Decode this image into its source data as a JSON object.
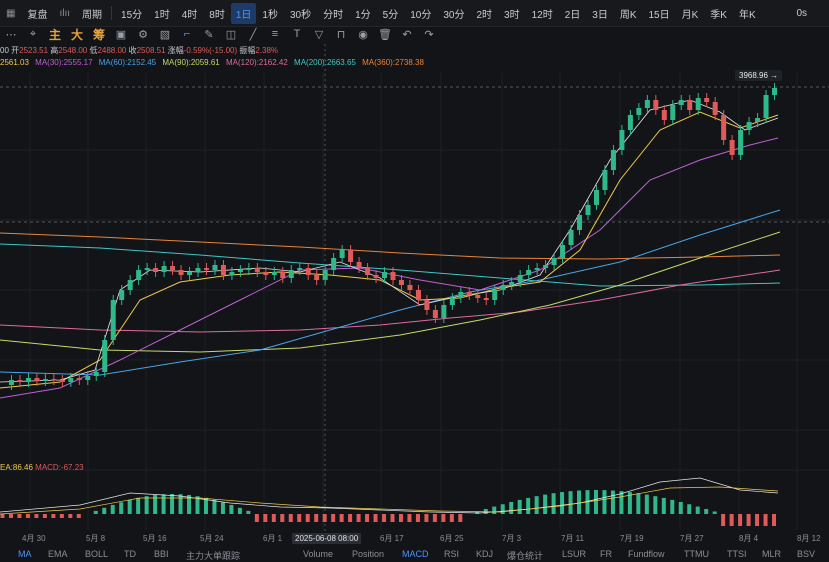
{
  "topbar": {
    "items": [
      "复盘",
      "周期",
      "15分",
      "1时",
      "4时",
      "8时",
      "1日",
      "1秒",
      "30秒",
      "分时",
      "1分",
      "5分",
      "10分",
      "30分",
      "2时",
      "3时",
      "12时",
      "2日",
      "3日",
      "周K",
      "15日",
      "月K",
      "季K",
      "年K"
    ],
    "active": "1日",
    "right": "0s"
  },
  "toolbar": {
    "main": "主",
    "big": "大",
    "chip": "筹"
  },
  "ohlc": {
    "prev_fragment": "00",
    "open_label": "开",
    "open": "2523.51",
    "high_label": "高",
    "high": "2548.00",
    "low_label": "低",
    "low": "2488.00",
    "close_label": "收",
    "close": "2508.51",
    "change_label": "涨幅",
    "change": "-0.59%(-15.00)",
    "amp_label": "振幅",
    "amp": "2.38%"
  },
  "ma_legend": [
    {
      "text": "2561.03",
      "color": "#f0c94b"
    },
    {
      "text": "MA(30):2555.17",
      "color": "#c05fd6"
    },
    {
      "text": "MA(60):2152.45",
      "color": "#4aa3e8"
    },
    {
      "text": "MA(90):2059.61",
      "color": "#c6d96a"
    },
    {
      "text": "MA(120):2162.42",
      "color": "#e06aa0"
    },
    {
      "text": "MA(200):2663.65",
      "color": "#3fc7c7"
    },
    {
      "text": "MA(360):2738.38",
      "color": "#e8843a"
    }
  ],
  "price_pill": "3968.96",
  "macd_legend": {
    "ea": "EA:86.46",
    "macd": "MACD:-67.23"
  },
  "xaxis": {
    "labels": [
      "4月 30",
      "5月 8",
      "5月 16",
      "5月 24",
      "6月 1",
      "6月 17",
      "6月 25",
      "7月 3",
      "7月 11",
      "7月 19",
      "7月 27",
      "8月 4",
      "8月 12"
    ],
    "tooltip": "2025-06-08 08:00"
  },
  "bottom_tabs": {
    "items": [
      "MA",
      "EMA",
      "BOLL",
      "TD",
      "BBI",
      "主力大单跟踪",
      "Volume",
      "Position",
      "MACD",
      "RSI",
      "KDJ",
      "爆仓统计",
      "LSUR",
      "FR",
      "Fundflow",
      "TTMU",
      "TTSI",
      "MLR",
      "BSV"
    ],
    "active": "MACD"
  },
  "colors": {
    "up": "#2fb98a",
    "down": "#e05a5a",
    "accent": "#4d94ff"
  }
}
